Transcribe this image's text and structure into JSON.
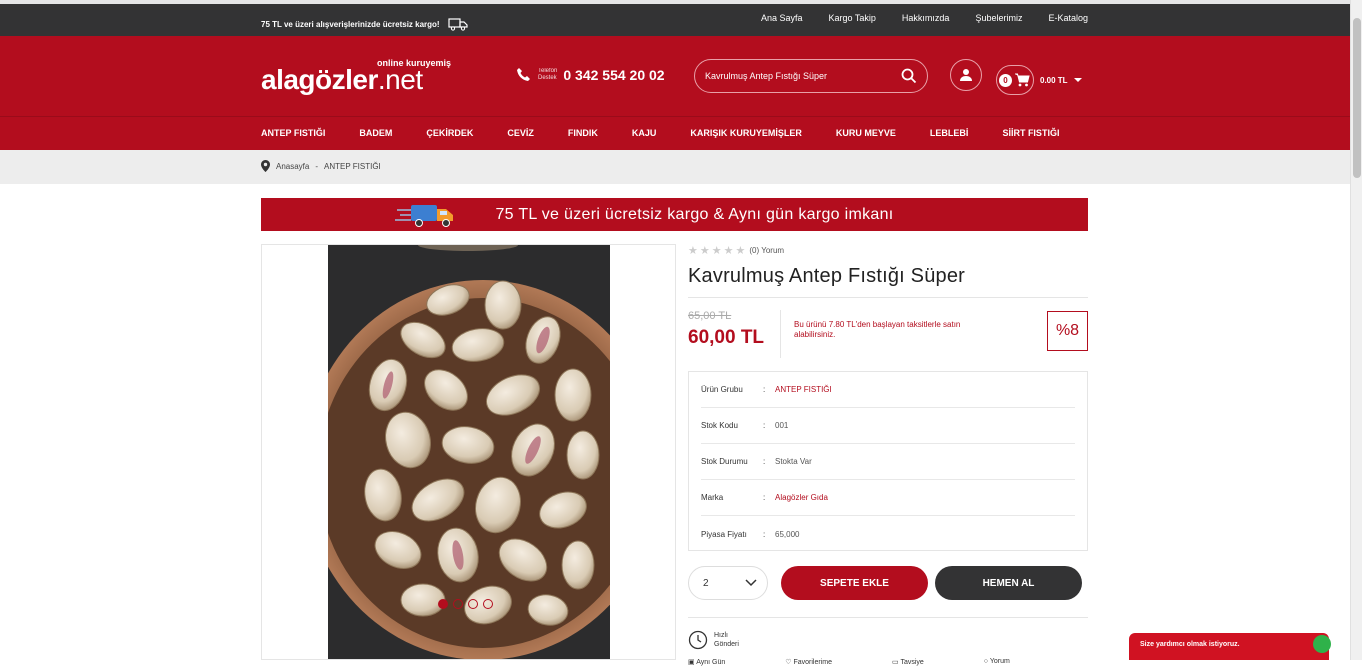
{
  "topbar": {
    "promo": "75 TL ve üzeri alışverişlerinizde ücretsiz kargo!",
    "links": [
      "Ana Sayfa",
      "Kargo Takip",
      "Hakkımızda",
      "Şubelerimiz",
      "E-Katalog"
    ]
  },
  "header": {
    "logo_sub": "online kuruyemiş",
    "logo_main": "alagözler",
    "logo_tld": ".net",
    "phone_label_1": "Telefon",
    "phone_label_2": "Destek",
    "phone_number": "0 342 554 20 02",
    "search_value": "Kavrulmuş Antep Fıstığı Süper",
    "cart_count": "0",
    "cart_total": "0.00 TL"
  },
  "nav": [
    "ANTEP FISTIĞI",
    "BADEM",
    "ÇEKİRDEK",
    "CEVİZ",
    "FINDIK",
    "KAJU",
    "KARIŞIK KURUYEMİŞLER",
    "KURU MEYVE",
    "LEBLEBİ",
    "SİİRT FISTIĞI"
  ],
  "breadcrumb": {
    "home": "Anasayfa",
    "sep": "-",
    "current": "ANTEP FISTIĞI"
  },
  "banner": "75 TL ve  üzeri ücretsiz kargo & Aynı gün kargo imkanı",
  "product": {
    "review": "(0) Yorum",
    "title": "Kavrulmuş Antep Fıstığı Süper",
    "old_price": "65,00 TL",
    "price": "60,00 TL",
    "installment": "Bu ürünü 7.80 TL'den başlayan taksitlerle satın alabilirsiniz.",
    "discount": "%8",
    "specs": [
      {
        "key": "Ürün Grubu",
        "value": "ANTEP FISTIĞI"
      },
      {
        "key": "Stok Kodu",
        "value": "001"
      },
      {
        "key": "Stok Durumu",
        "value": "Stokta Var"
      },
      {
        "key": "Marka",
        "value": "Alagözler Gıda"
      },
      {
        "key": "Piyasa Fiyatı",
        "value": "65,000"
      }
    ],
    "quantity": "2",
    "add_to_cart": "SEPETE EKLE",
    "buy_now": "HEMEN AL",
    "feature_fast_1": "Hızlı",
    "feature_fast_2": "Gönderi",
    "feature_row": [
      "Aynı Gün",
      "Favorilerime",
      "Tavsiye",
      "Yorum"
    ]
  },
  "chat": "Size yardımcı olmak istiyoruz.",
  "colors": {
    "brand": "#b30d1e",
    "dark": "#333334"
  }
}
